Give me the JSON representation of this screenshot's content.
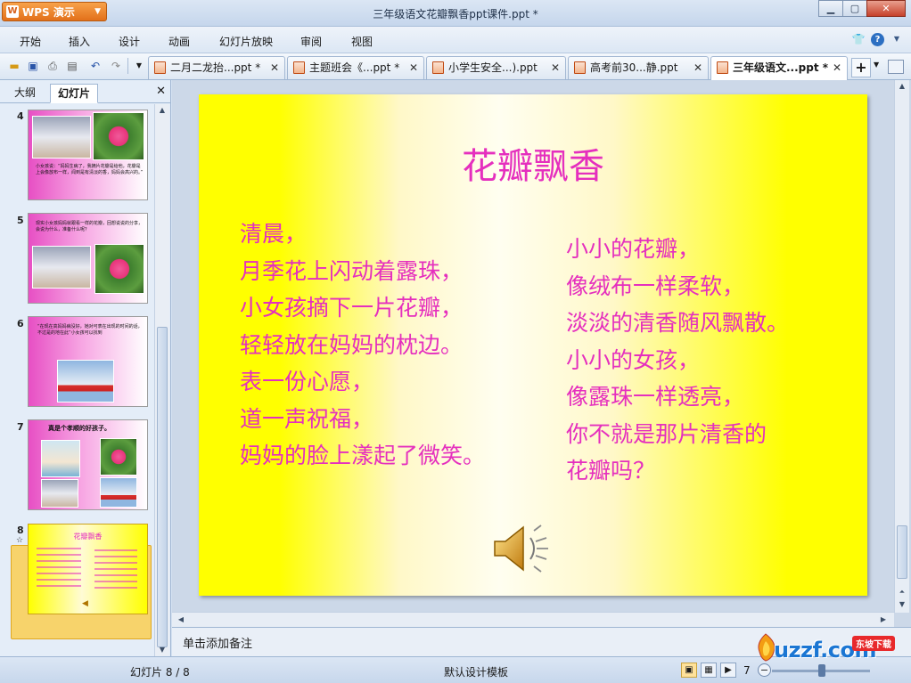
{
  "app": {
    "name": "WPS 演示",
    "window_title": "三年级语文花瓣飘香ppt课件.ppt *"
  },
  "menu": [
    "开始",
    "插入",
    "设计",
    "动画",
    "幻灯片放映",
    "审阅",
    "视图"
  ],
  "doc_tabs": [
    {
      "label": "二月二龙抬...ppt *",
      "active": false
    },
    {
      "label": "主题班会《...ppt *",
      "active": false
    },
    {
      "label": "小学生安全...).ppt",
      "active": false
    },
    {
      "label": "高考前30...静.ppt",
      "active": false
    },
    {
      "label": "三年级语文...ppt *",
      "active": true
    }
  ],
  "left_panel": {
    "tabs": [
      "大纲",
      "幻灯片"
    ],
    "active_tab": "幻灯片",
    "slides": [
      {
        "number": "4",
        "text": "小女孩说：“妈妈生病了，我摘片花瓣是给他，花瓣是上会像放布一样，闻到是有清淡的香，妈妈会高兴的。”"
      },
      {
        "number": "5",
        "text": "现实小女孩妈妈就跟看一样的花瓣，回想说说的分享，会说为什么，准备什么呢？"
      },
      {
        "number": "6",
        "text": "“在现在高妈妈病没好，她对可表在出现的时间的话，不过是的地在此”小女孩可以找到"
      },
      {
        "number": "7",
        "text": "真是个孝顺的好孩子。"
      },
      {
        "number": "8",
        "title": "花瓣飘香",
        "selected": true
      }
    ]
  },
  "slide": {
    "title": "花瓣飘香",
    "left_lines": [
      "清晨，",
      "月季花上闪动着露珠，",
      "小女孩摘下一片花瓣，",
      "轻轻放在妈妈的枕边。",
      "表一份心愿，",
      "道一声祝福，",
      "妈妈的脸上漾起了微笑。"
    ],
    "right_lines": [
      "小小的花瓣，",
      "像绒布一样柔软，",
      "淡淡的清香随风飘散。",
      "小小的女孩，",
      "像露珠一样透亮，",
      "你不就是那片清香的",
      "花瓣吗？"
    ],
    "colors": {
      "text": "#e52fbe",
      "background": "#ffff00"
    }
  },
  "notes": {
    "placeholder": "单击添加备注"
  },
  "status": {
    "slide_counter": "幻灯片 8 / 8",
    "template": "默认设计模板",
    "zoom": "7"
  },
  "watermark": {
    "text": "uzzf.com",
    "badge": "东坡下载"
  }
}
